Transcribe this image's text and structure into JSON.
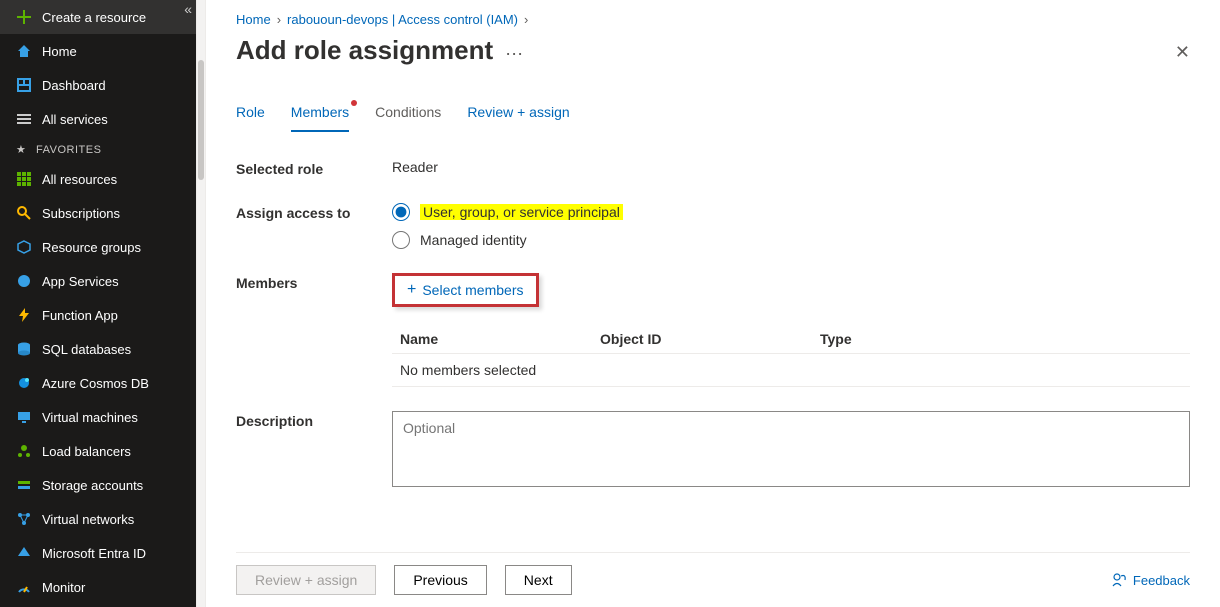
{
  "breadcrumb": {
    "home": "Home",
    "item1": "rabououn-devops | Access control (IAM)"
  },
  "page_title": "Add role assignment",
  "tabs": {
    "role": "Role",
    "members": "Members",
    "conditions": "Conditions",
    "review": "Review + assign"
  },
  "labels": {
    "selected_role": "Selected role",
    "assign_access": "Assign access to",
    "members": "Members",
    "description": "Description"
  },
  "values": {
    "selected_role": "Reader",
    "no_members": "No members selected"
  },
  "radio": {
    "user": "User, group, or service principal",
    "managed": "Managed identity"
  },
  "select_members": "Select members",
  "table": {
    "c1": "Name",
    "c2": "Object ID",
    "c3": "Type"
  },
  "description_placeholder": "Optional",
  "buttons": {
    "review": "Review + assign",
    "previous": "Previous",
    "next": "Next"
  },
  "feedback": "Feedback",
  "sidebar": {
    "create": "Create a resource",
    "home": "Home",
    "dashboard": "Dashboard",
    "all_services": "All services",
    "favorites": "FAVORITES",
    "all_resources": "All resources",
    "subscriptions": "Subscriptions",
    "resource_groups": "Resource groups",
    "app_services": "App Services",
    "function_app": "Function App",
    "sql_db": "SQL databases",
    "cosmos": "Azure Cosmos DB",
    "vms": "Virtual machines",
    "lb": "Load balancers",
    "storage": "Storage accounts",
    "vnet": "Virtual networks",
    "entra": "Microsoft Entra ID",
    "monitor": "Monitor"
  }
}
